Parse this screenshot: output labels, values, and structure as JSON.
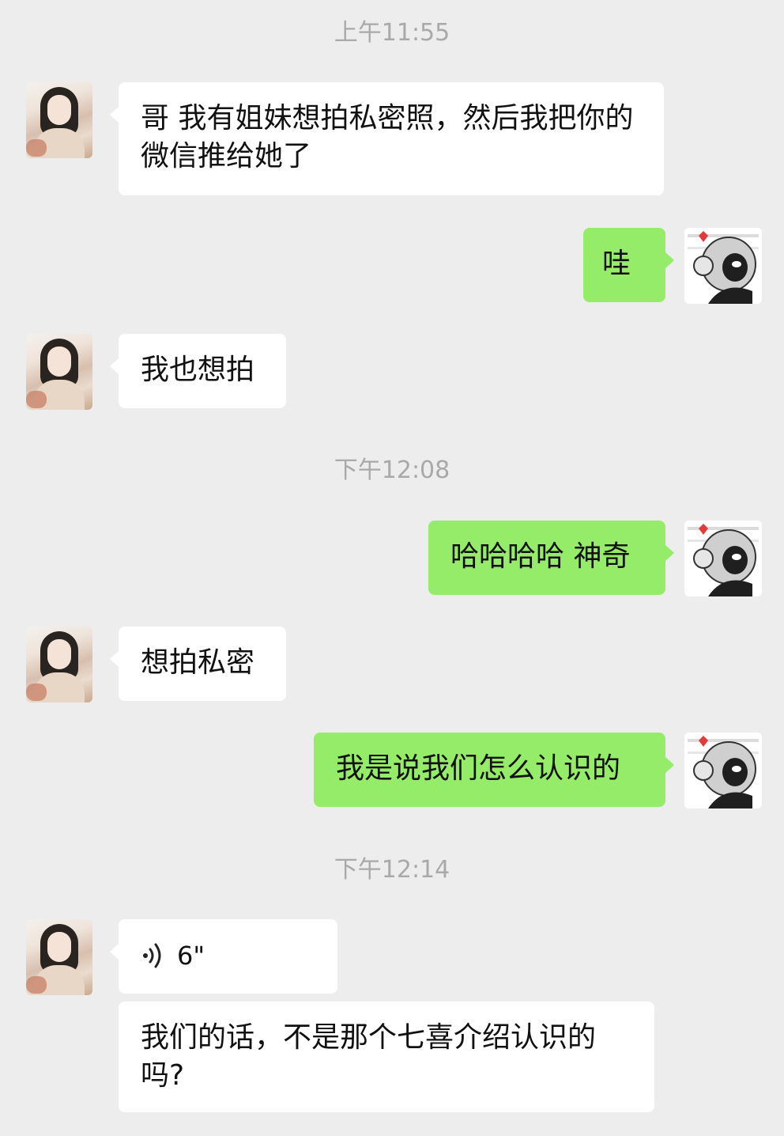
{
  "timestamps": [
    "上午11:55",
    "下午12:08",
    "下午12:14"
  ],
  "messages": [
    {
      "from": "her",
      "text": "哥 我有姐妹想拍私密照，然后我把你的微信推给她了"
    },
    {
      "from": "me",
      "text": "哇"
    },
    {
      "from": "her",
      "text": "我也想拍"
    },
    {
      "from": "me",
      "text": "哈哈哈哈 神奇"
    },
    {
      "from": "her",
      "text": "想拍私密"
    },
    {
      "from": "me",
      "text": "我是说我们怎么认识的"
    },
    {
      "from": "her",
      "type": "voice",
      "duration": "6\""
    },
    {
      "from": "her",
      "text": "我们的话，不是那个七喜介绍认识的吗?"
    }
  ],
  "icons": {
    "voice": "voice-wave-icon"
  },
  "colors": {
    "background": "#ededed",
    "incoming_bubble": "#ffffff",
    "outgoing_bubble": "#95ec69",
    "timestamp": "#a9a9a9"
  }
}
